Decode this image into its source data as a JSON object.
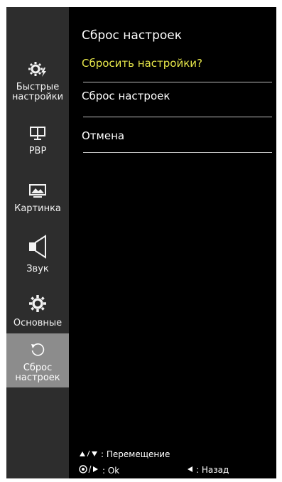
{
  "sidebar": {
    "items": [
      {
        "icon": "quick-settings-icon",
        "label": "Быстрые\nнастройки"
      },
      {
        "icon": "pbp-icon",
        "label": "PBP"
      },
      {
        "icon": "picture-icon",
        "label": "Картинка"
      },
      {
        "icon": "speaker-icon",
        "label": "Звук"
      },
      {
        "icon": "gear-icon",
        "label": "Основные"
      },
      {
        "icon": "reset-icon",
        "label": "Сброс\nнастроек"
      }
    ],
    "active_index": 5
  },
  "main": {
    "title": "Сброс настроек",
    "question": "Сбросить настройки?",
    "options": [
      "Сброс настроек",
      "Отмена"
    ]
  },
  "hints": {
    "move_label": ": Перемещение",
    "ok_label": ": Ok",
    "back_label": ": Назад"
  },
  "colors": {
    "question": "#e6e64a",
    "active_item": "#8c8c8c",
    "sidebar": "#2d2d2d",
    "background": "#000000"
  }
}
